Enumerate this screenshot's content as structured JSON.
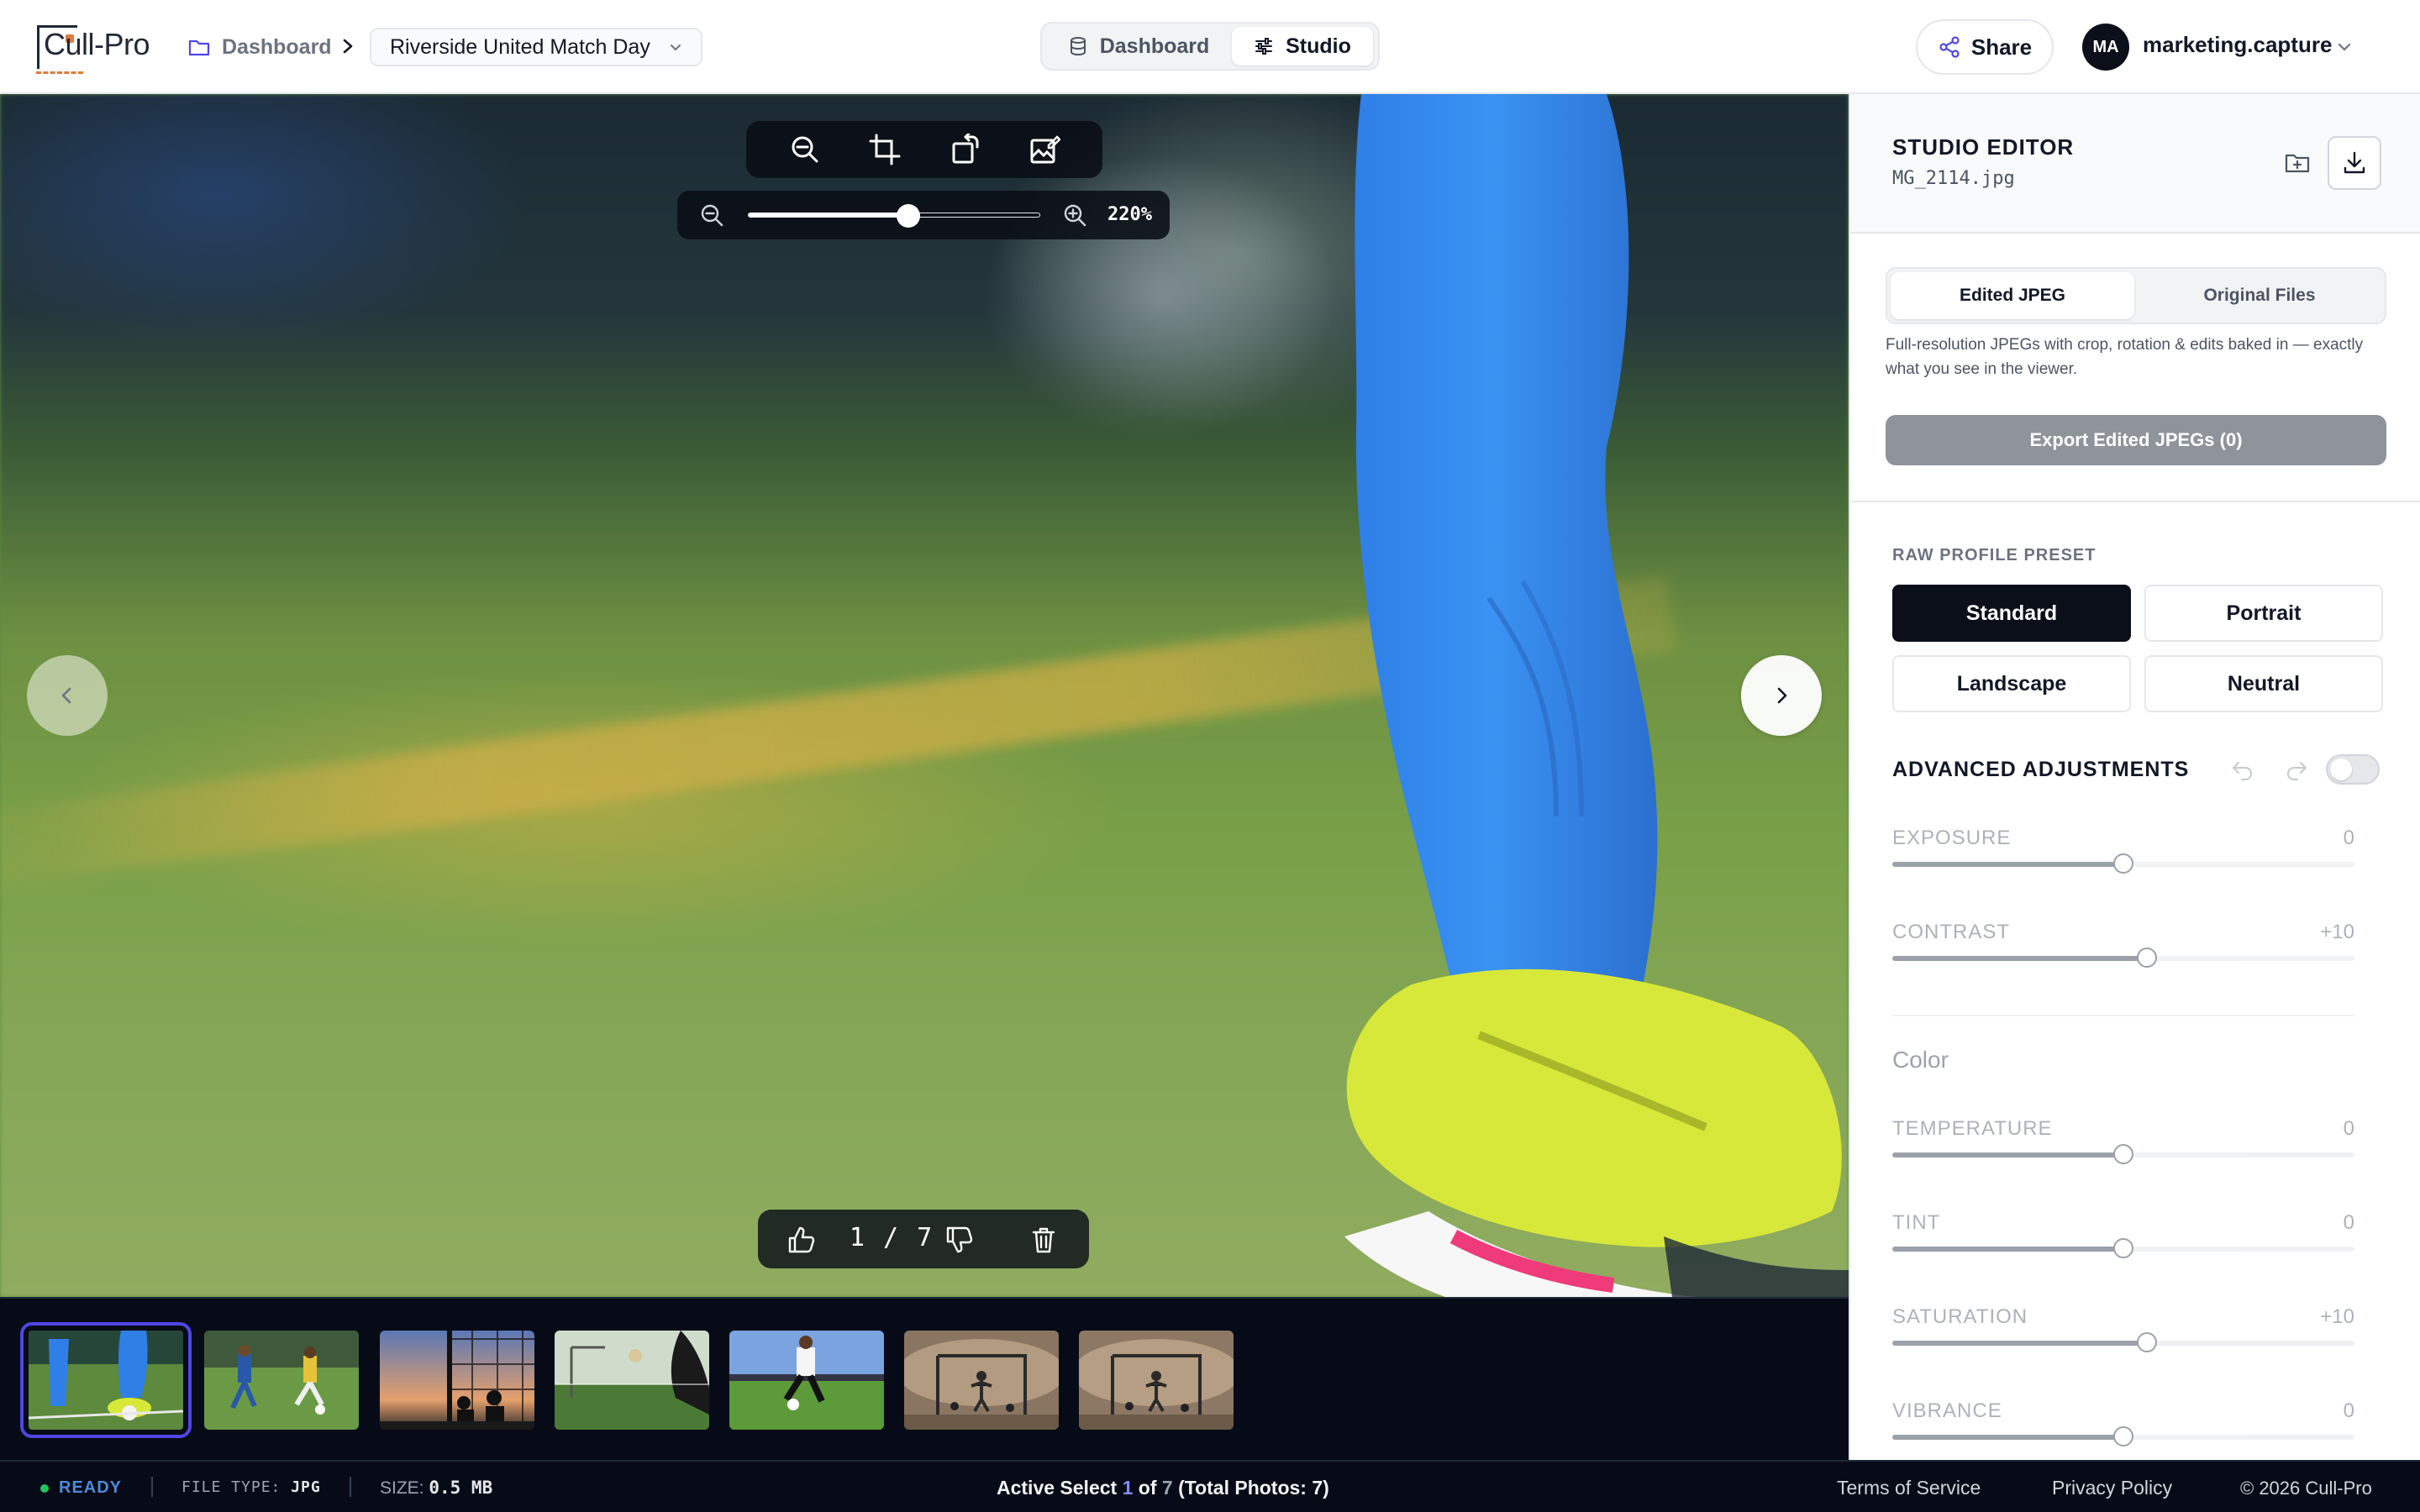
{
  "header": {
    "logo": "Cull-Pro",
    "breadcrumb_root": "Dashboard",
    "project": "Riverside United Match Day",
    "view_tabs": [
      {
        "label": "Dashboard",
        "icon": "database-icon",
        "active": false
      },
      {
        "label": "Studio",
        "icon": "sliders-icon",
        "active": true
      }
    ],
    "share_label": "Share",
    "user_initials": "MA",
    "user_name": "marketing.capture"
  },
  "viewer": {
    "zoom_label": "220%",
    "zoom_fraction": 0.55,
    "counter": "1 / 7",
    "tools": [
      "zoom-out-icon",
      "crop-icon",
      "rotate-icon",
      "image-edit-icon"
    ]
  },
  "filmstrip": {
    "active_index": 0,
    "thumbs": [
      {
        "name": "thumb-1",
        "colors": [
          "#5b8a3a",
          "#2a7de0"
        ]
      },
      {
        "name": "thumb-2",
        "colors": [
          "#4d7b3b",
          "#d8d8d8"
        ]
      },
      {
        "name": "thumb-3",
        "colors": [
          "#6a7fb0",
          "#e9a16a"
        ]
      },
      {
        "name": "thumb-4",
        "colors": [
          "#c9d6c2",
          "#456a3a"
        ]
      },
      {
        "name": "thumb-5",
        "colors": [
          "#6b8fd0",
          "#5a8d3a"
        ]
      },
      {
        "name": "thumb-6",
        "colors": [
          "#9b8570",
          "#6b5948"
        ]
      },
      {
        "name": "thumb-7",
        "colors": [
          "#a08a74",
          "#6e5b49"
        ]
      }
    ]
  },
  "status": {
    "ready": "READY",
    "file_type_label": "FILE TYPE:",
    "file_type": "JPG",
    "size_label": "SIZE:",
    "size": "0.5 MB",
    "active_prefix": "Active Select",
    "active_index": "1",
    "active_of": "of",
    "active_total": "7",
    "active_suffix": "(Total Photos: 7)",
    "links": [
      "Terms of Service",
      "Privacy Policy"
    ],
    "copyright": "© 2026 Cull-Pro"
  },
  "panel": {
    "title": "STUDIO EDITOR",
    "filename": "MG_2114.jpg",
    "export_tabs": [
      {
        "label": "Edited JPEG",
        "active": true
      },
      {
        "label": "Original Files",
        "active": false
      }
    ],
    "export_desc": "Full-resolution JPEGs with crop, rotation & edits baked in — exactly what you see in the viewer.",
    "export_button": "Export Edited JPEGs (0)",
    "preset_label": "RAW PROFILE PRESET",
    "presets": [
      {
        "label": "Standard",
        "active": true
      },
      {
        "label": "Portrait",
        "active": false
      },
      {
        "label": "Landscape",
        "active": false
      },
      {
        "label": "Neutral",
        "active": false
      }
    ],
    "advanced_title": "ADVANCED ADJUSTMENTS",
    "advanced_enabled": false,
    "adjustments": [
      {
        "name": "EXPOSURE",
        "value": "0",
        "level": 0.5
      },
      {
        "name": "CONTRAST",
        "value": "+10",
        "level": 0.55
      }
    ],
    "color_group": "Color",
    "color_adjustments": [
      {
        "name": "TEMPERATURE",
        "value": "0",
        "level": 0.5
      },
      {
        "name": "TINT",
        "value": "0",
        "level": 0.5
      },
      {
        "name": "SATURATION",
        "value": "+10",
        "level": 0.55
      },
      {
        "name": "VIBRANCE",
        "value": "0",
        "level": 0.5
      }
    ]
  },
  "colors": {
    "accent": "#4f46e5",
    "dark": "#0b0f19",
    "export_disabled": "#8f949b"
  }
}
